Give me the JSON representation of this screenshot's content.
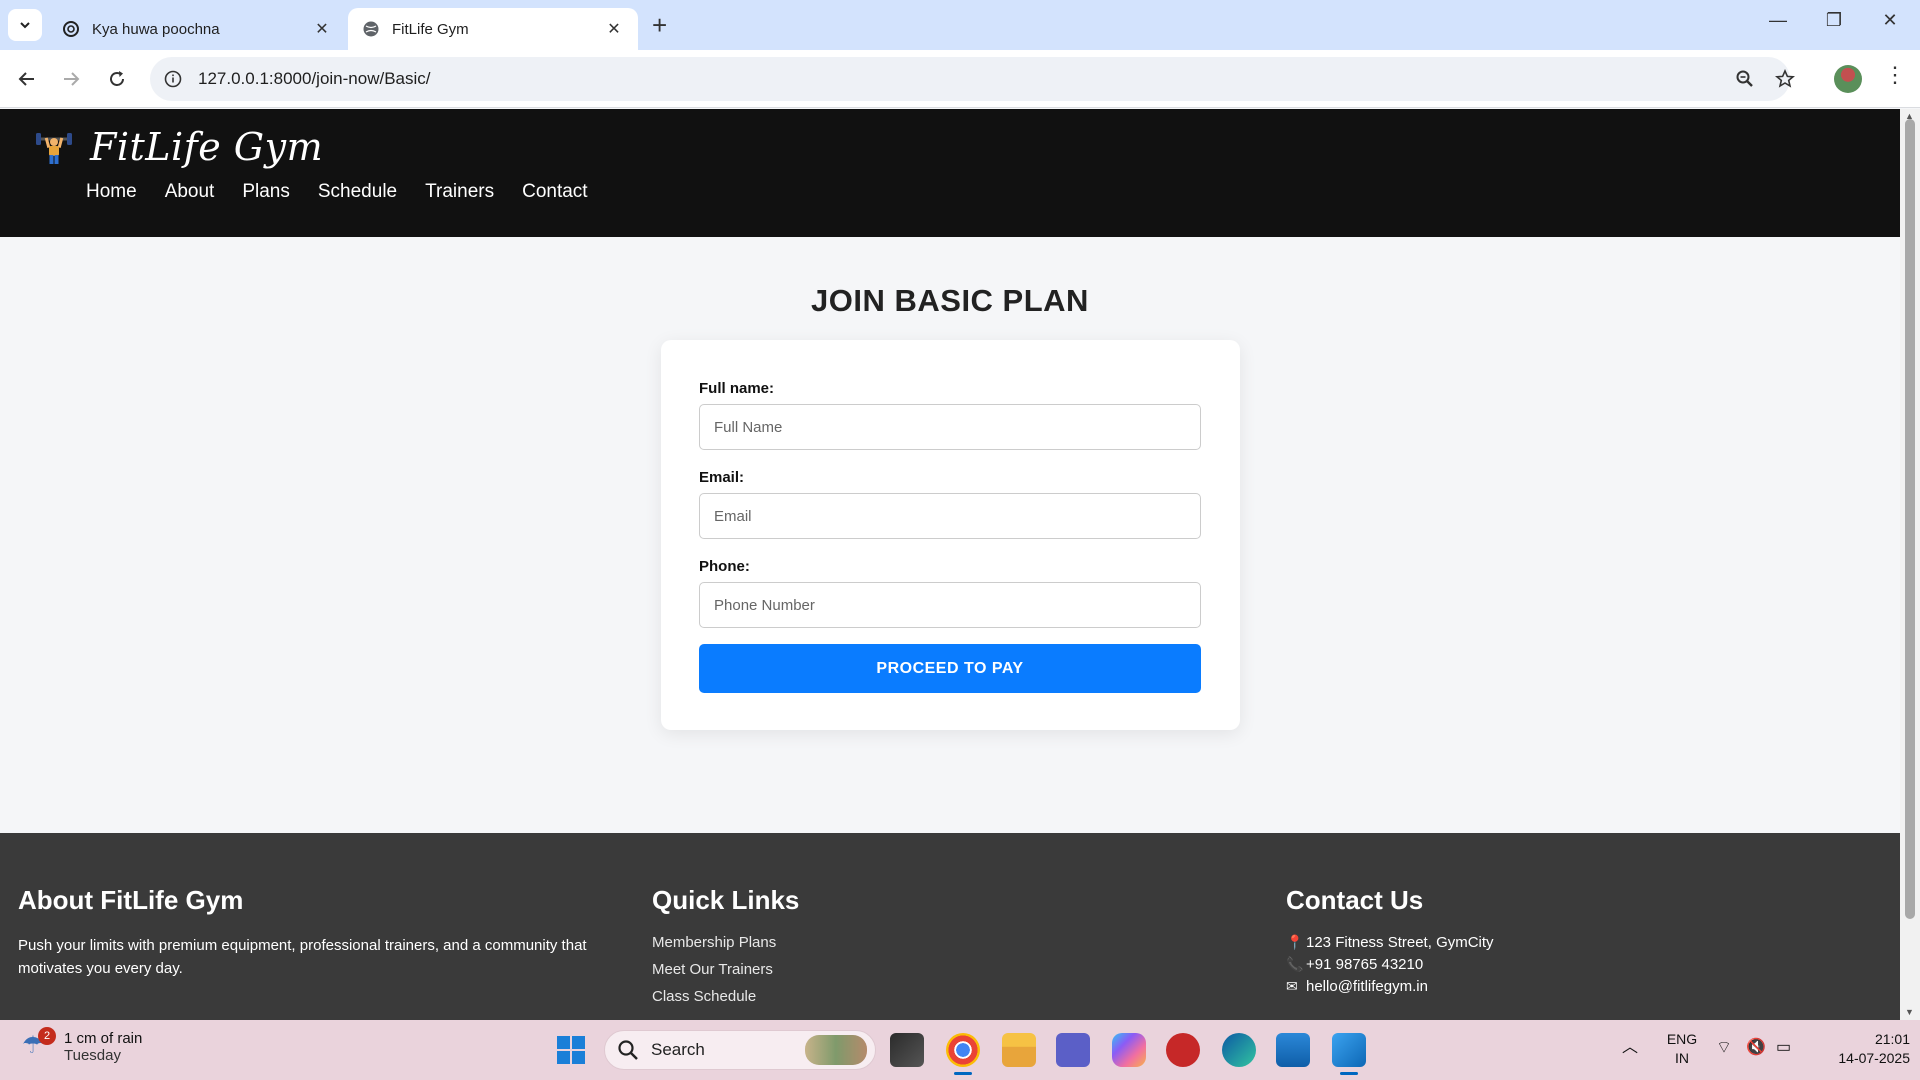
{
  "browser": {
    "tabs": [
      {
        "title": "Kya huwa poochna",
        "active": false
      },
      {
        "title": "FitLife Gym",
        "active": true
      }
    ],
    "url": "127.0.0.1:8000/join-now/Basic/"
  },
  "site": {
    "brand": "FitLife Gym",
    "nav": [
      "Home",
      "About",
      "Plans",
      "Schedule",
      "Trainers",
      "Contact"
    ]
  },
  "form": {
    "title": "JOIN BASIC PLAN",
    "fields": [
      {
        "label": "Full name:",
        "placeholder": "Full Name"
      },
      {
        "label": "Email:",
        "placeholder": "Email"
      },
      {
        "label": "Phone:",
        "placeholder": "Phone Number"
      }
    ],
    "submit_label": "PROCEED TO PAY"
  },
  "footer": {
    "about": {
      "heading": "About FitLife Gym",
      "text": "Push your limits with premium equipment, professional trainers, and a community that motivates you every day."
    },
    "links": {
      "heading": "Quick Links",
      "items": [
        "Membership Plans",
        "Meet Our Trainers",
        "Class Schedule"
      ]
    },
    "contact": {
      "heading": "Contact Us",
      "address": "123 Fitness Street, GymCity",
      "phone": "+91 98765 43210",
      "email": "hello@fitlifegym.in"
    }
  },
  "taskbar": {
    "weather": {
      "badge": "2",
      "line1": "1 cm of rain",
      "line2": "Tuesday"
    },
    "search_label": "Search",
    "language": {
      "line1": "ENG",
      "line2": "IN"
    },
    "time": "21:01",
    "date": "14-07-2025"
  },
  "colors": {
    "header_bg": "#111111",
    "accent": "#0a7cff",
    "footer_bg": "#3a3a3a"
  }
}
